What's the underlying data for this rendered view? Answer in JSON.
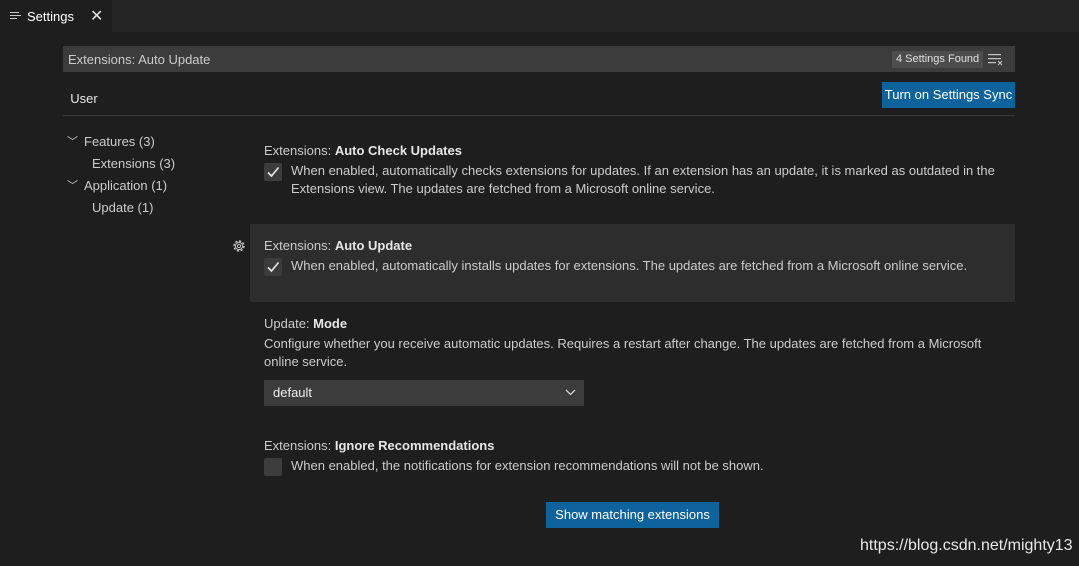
{
  "tab": {
    "title": "Settings"
  },
  "search": {
    "value": "Extensions: Auto Update",
    "found_badge": "4 Settings Found"
  },
  "scope_tab": "User",
  "sync_button": "Turn on Settings Sync",
  "toc": [
    {
      "label": "Features (3)"
    },
    {
      "label": "Extensions (3)"
    },
    {
      "label": "Application (1)"
    },
    {
      "label": "Update (1)"
    }
  ],
  "settings": [
    {
      "category": "Extensions: ",
      "name": "Auto Check Updates",
      "description_line1": "When enabled, automatically checks extensions for updates. If an extension has an update, it is marked as outdated in the",
      "description_line2": "Extensions view. The updates are fetched from a Microsoft online service.",
      "checked": true
    },
    {
      "category": "Extensions: ",
      "name": "Auto Update",
      "description_line1": "When enabled, automatically installs updates for extensions. The updates are fetched from a Microsoft online service.",
      "checked": true
    },
    {
      "category": "Update: ",
      "name": "Mode",
      "description_line1": "Configure whether you receive automatic updates. Requires a restart after change. The updates are fetched from a Microsoft",
      "description_line2": "online service.",
      "selected_value": "default"
    },
    {
      "category": "Extensions: ",
      "name": "Ignore Recommendations",
      "description_line1": "When enabled, the notifications for extension recommendations will not be shown.",
      "checked": false
    }
  ],
  "show_extensions_button": "Show matching extensions",
  "watermark": "https://blog.csdn.net/mighty13",
  "colors": {
    "accent_button": "#0e639c",
    "background": "#1e1e1e",
    "input": "#3c3c3c"
  }
}
